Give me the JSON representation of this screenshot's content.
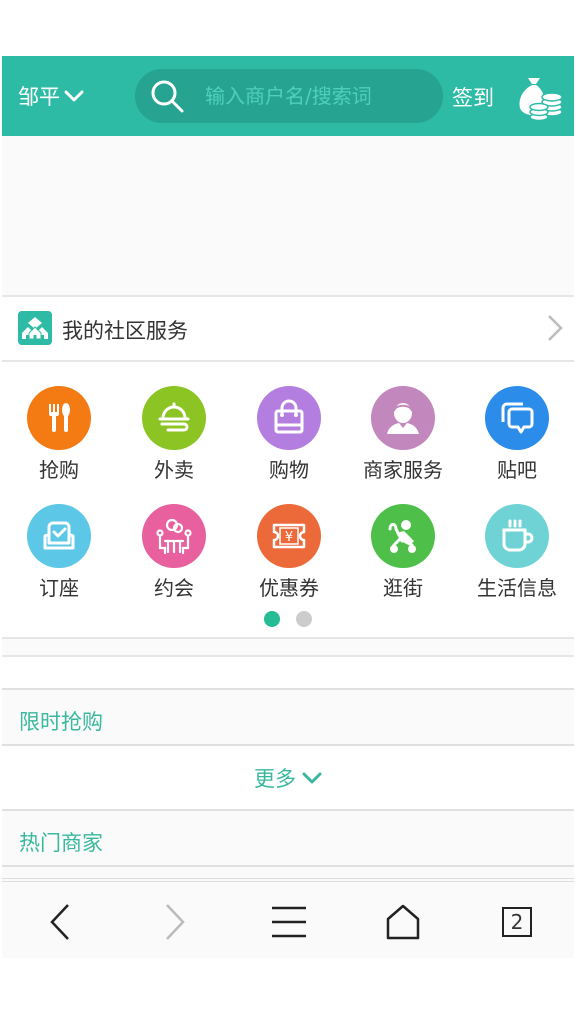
{
  "header": {
    "city": "邹平",
    "search_placeholder": "输入商户名/搜索词",
    "signin_label": "签到",
    "accent_color": "#2dbba6"
  },
  "community": {
    "title": "我的社区服务"
  },
  "grid": {
    "items": [
      {
        "label": "抢购",
        "icon": "cutlery-icon",
        "color": "#f47a14"
      },
      {
        "label": "外卖",
        "icon": "food-cover-icon",
        "color": "#8cc424"
      },
      {
        "label": "购物",
        "icon": "shopping-bag-icon",
        "color": "#b47ee0"
      },
      {
        "label": "商家服务",
        "icon": "merchant-person-icon",
        "color": "#c287bd"
      },
      {
        "label": "贴吧",
        "icon": "chat-bubbles-icon",
        "color": "#2b8cea"
      },
      {
        "label": "订座",
        "icon": "sofa-icon",
        "color": "#5cc7e6"
      },
      {
        "label": "约会",
        "icon": "dating-table-icon",
        "color": "#e9609e"
      },
      {
        "label": "优惠券",
        "icon": "coupon-icon",
        "color": "#ec6a3a"
      },
      {
        "label": "逛街",
        "icon": "stroller-icon",
        "color": "#4ec04a"
      },
      {
        "label": "生活信息",
        "icon": "coffee-cup-icon",
        "color": "#6fd3d6"
      }
    ],
    "pagination": {
      "pages": 2,
      "active": 1
    }
  },
  "sections": {
    "flash_sale": "限时抢购",
    "more_label": "更多",
    "hot_merchants": "热门商家"
  },
  "bottom_nav": {
    "tab_count": "2"
  }
}
